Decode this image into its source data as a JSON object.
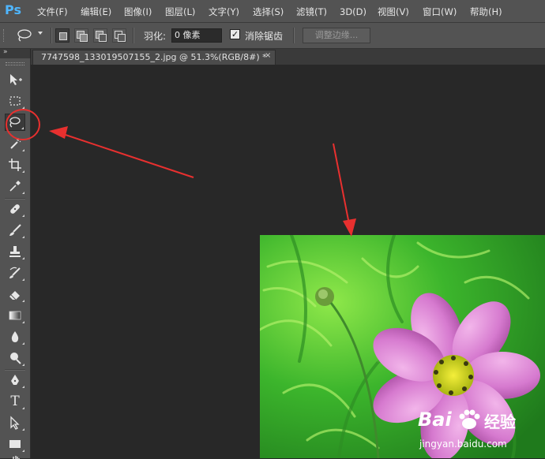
{
  "app": {
    "logo": "Ps"
  },
  "menu": [
    {
      "label": "文件(F)"
    },
    {
      "label": "编辑(E)"
    },
    {
      "label": "图像(I)"
    },
    {
      "label": "图层(L)"
    },
    {
      "label": "文字(Y)"
    },
    {
      "label": "选择(S)"
    },
    {
      "label": "滤镜(T)"
    },
    {
      "label": "3D(D)"
    },
    {
      "label": "视图(V)"
    },
    {
      "label": "窗口(W)"
    },
    {
      "label": "帮助(H)"
    }
  ],
  "options": {
    "feather_label": "羽化:",
    "feather_value": "0 像素",
    "antialias_label": "消除锯齿",
    "antialias_checked": true,
    "refine_edge_label": "调整边缘..."
  },
  "document": {
    "tab_title": "7747598_133019507155_2.jpg @ 51.3%(RGB/8#) *",
    "close_glyph": "×"
  },
  "tools": [
    {
      "icon": "move-icon"
    },
    {
      "icon": "rectangular-marquee-icon"
    },
    {
      "icon": "lasso-icon",
      "active": true
    },
    {
      "icon": "magic-wand-icon"
    },
    {
      "icon": "crop-icon"
    },
    {
      "icon": "eyedropper-icon"
    },
    {
      "icon": "healing-brush-icon"
    },
    {
      "icon": "brush-icon"
    },
    {
      "icon": "clone-stamp-icon"
    },
    {
      "icon": "history-brush-icon"
    },
    {
      "icon": "eraser-icon"
    },
    {
      "icon": "gradient-icon"
    },
    {
      "icon": "blur-icon"
    },
    {
      "icon": "dodge-icon"
    },
    {
      "icon": "pen-icon"
    },
    {
      "icon": "type-icon"
    },
    {
      "icon": "path-selection-icon"
    },
    {
      "icon": "rectangle-shape-icon"
    },
    {
      "icon": "hand-icon"
    }
  ],
  "type_tool_glyph": "T",
  "watermark": {
    "brand": "Bai",
    "brand_cn": "经验",
    "url": "jingyan.baidu.com"
  },
  "colors": {
    "annotation": "#e8302f",
    "ps_blue": "#4fb6ff",
    "panel": "#535353",
    "canvas": "#282828"
  }
}
